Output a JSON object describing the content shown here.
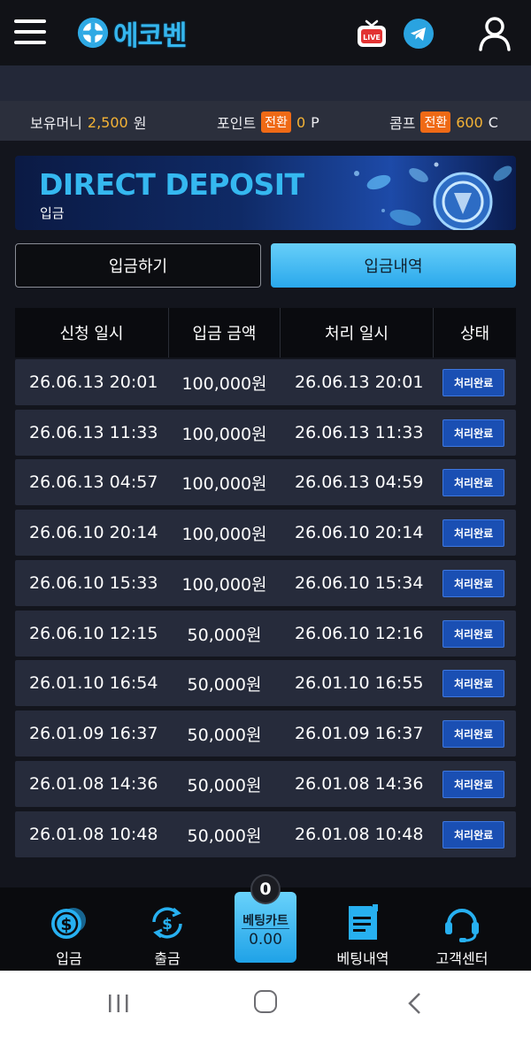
{
  "header": {
    "logo_text": "에코벤",
    "live_badge": "LIVE"
  },
  "wallet": {
    "money_label": "보유머니",
    "money_value": "2,500",
    "money_unit": "원",
    "point_label": "포인트",
    "point_convert": "전환",
    "point_value": "0",
    "point_unit": "P",
    "comp_label": "콤프",
    "comp_convert": "전환",
    "comp_value": "600",
    "comp_unit": "C"
  },
  "banner": {
    "title": "DIRECT DEPOSIT",
    "subtitle": "입금"
  },
  "tabs": {
    "deposit": "입금하기",
    "history": "입금내역"
  },
  "table": {
    "headers": [
      "신청 일시",
      "입금 금액",
      "처리 일시",
      "상태"
    ],
    "rows": [
      [
        "26.06.13 20:01",
        "100,000원",
        "26.06.13 20:01",
        "처리완료"
      ],
      [
        "26.06.13 11:33",
        "100,000원",
        "26.06.13 11:33",
        "처리완료"
      ],
      [
        "26.06.13 04:57",
        "100,000원",
        "26.06.13 04:59",
        "처리완료"
      ],
      [
        "26.06.10 20:14",
        "100,000원",
        "26.06.10 20:14",
        "처리완료"
      ],
      [
        "26.06.10 15:33",
        "100,000원",
        "26.06.10 15:34",
        "처리완료"
      ],
      [
        "26.06.10 12:15",
        "50,000원",
        "26.06.10 12:16",
        "처리완료"
      ],
      [
        "26.01.10 16:54",
        "50,000원",
        "26.01.10 16:55",
        "처리완료"
      ],
      [
        "26.01.09 16:37",
        "50,000원",
        "26.01.09 16:37",
        "처리완료"
      ],
      [
        "26.01.08 14:36",
        "50,000원",
        "26.01.08 14:36",
        "처리완료"
      ],
      [
        "26.01.08 10:48",
        "50,000원",
        "26.01.08 10:48",
        "처리완료"
      ]
    ]
  },
  "bottom_nav": {
    "deposit": "입금",
    "withdraw": "출금",
    "cart_label": "베팅카트",
    "cart_value": "0.00",
    "cart_count": "0",
    "bet_history": "베팅내역",
    "support": "고객센터"
  },
  "colors": {
    "accent": "#35b6ee",
    "gold": "#f5b335",
    "convert_badge": "#ef6a16",
    "status_badge": "#1a4fb3"
  },
  "icons": [
    "menu-icon",
    "live-tv-icon",
    "telegram-icon",
    "user-icon",
    "dollar-coin-icon",
    "dollar-exchange-icon",
    "document-icon",
    "headset-icon"
  ]
}
